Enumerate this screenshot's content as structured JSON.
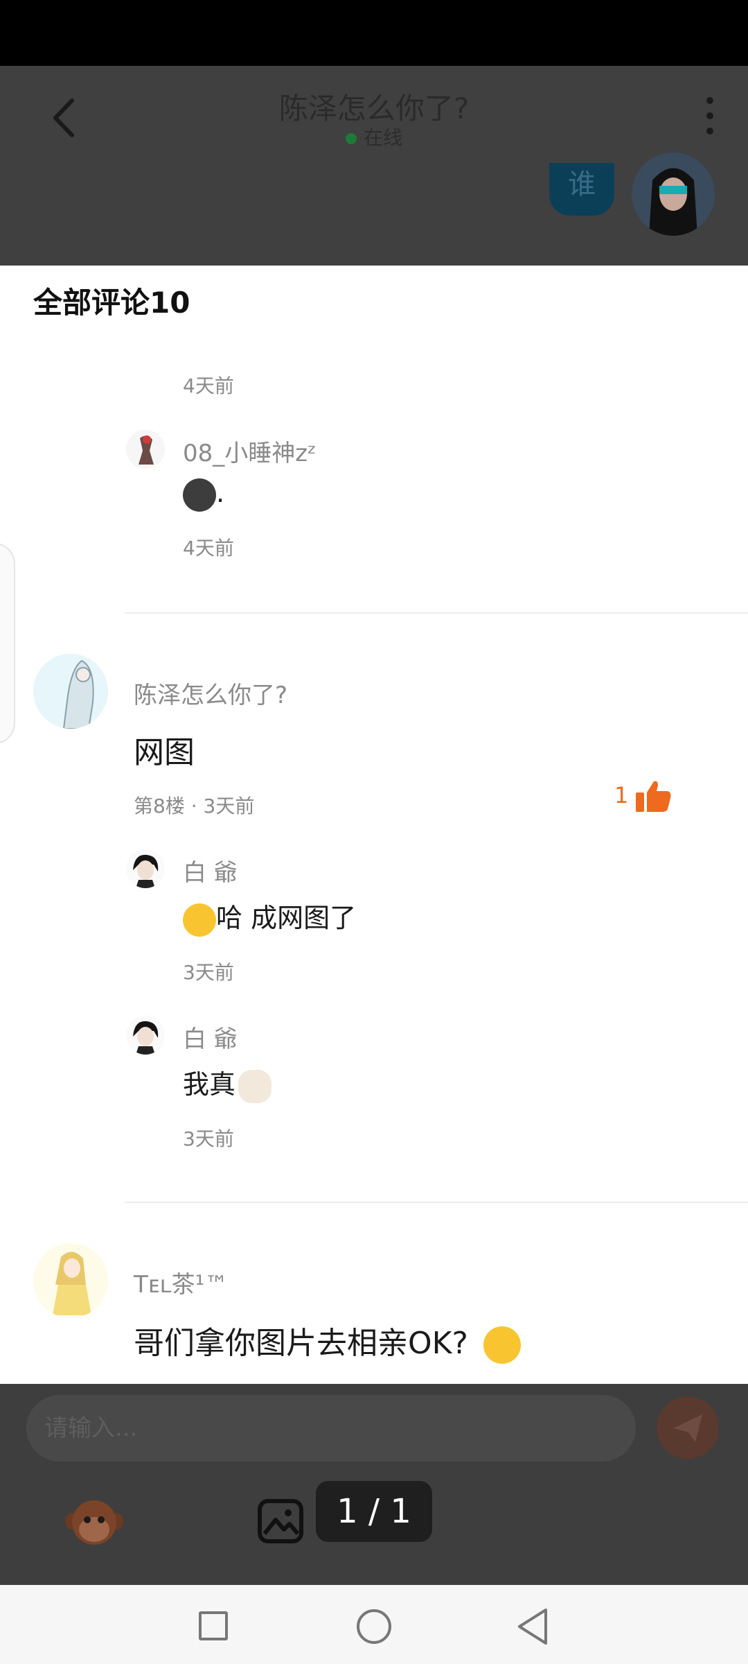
{
  "header": {
    "title": "陈泽怎么你了?",
    "status": "在线",
    "bubble_text": "谁"
  },
  "sheet": {
    "title": "全部评论10"
  },
  "comments_top": {
    "first_reply_time": "4天前",
    "reply2_name": "08_小睡神zᶻ",
    "reply2_suffix": ".",
    "reply2_time": "4天前"
  },
  "comment_8": {
    "author": "陈泽怎么你了?",
    "text": "网图",
    "meta": "第8楼 · 3天前",
    "likes": "1",
    "replies": [
      {
        "name": "白 爺",
        "text": "哈  成网图了",
        "time": "3天前"
      },
      {
        "name": "白 爺",
        "text": "我真",
        "time": "3天前"
      }
    ]
  },
  "comment_next": {
    "author": "Tᴇʟ茶¹™",
    "text": "哥们拿你图片去相亲OK?"
  },
  "input": {
    "placeholder": "请输入..."
  },
  "pager": {
    "label": "1 / 1"
  },
  "colors": {
    "like": "#ee6a1e",
    "overlay": "#3d3d3d",
    "sheet": "#ffffff"
  }
}
